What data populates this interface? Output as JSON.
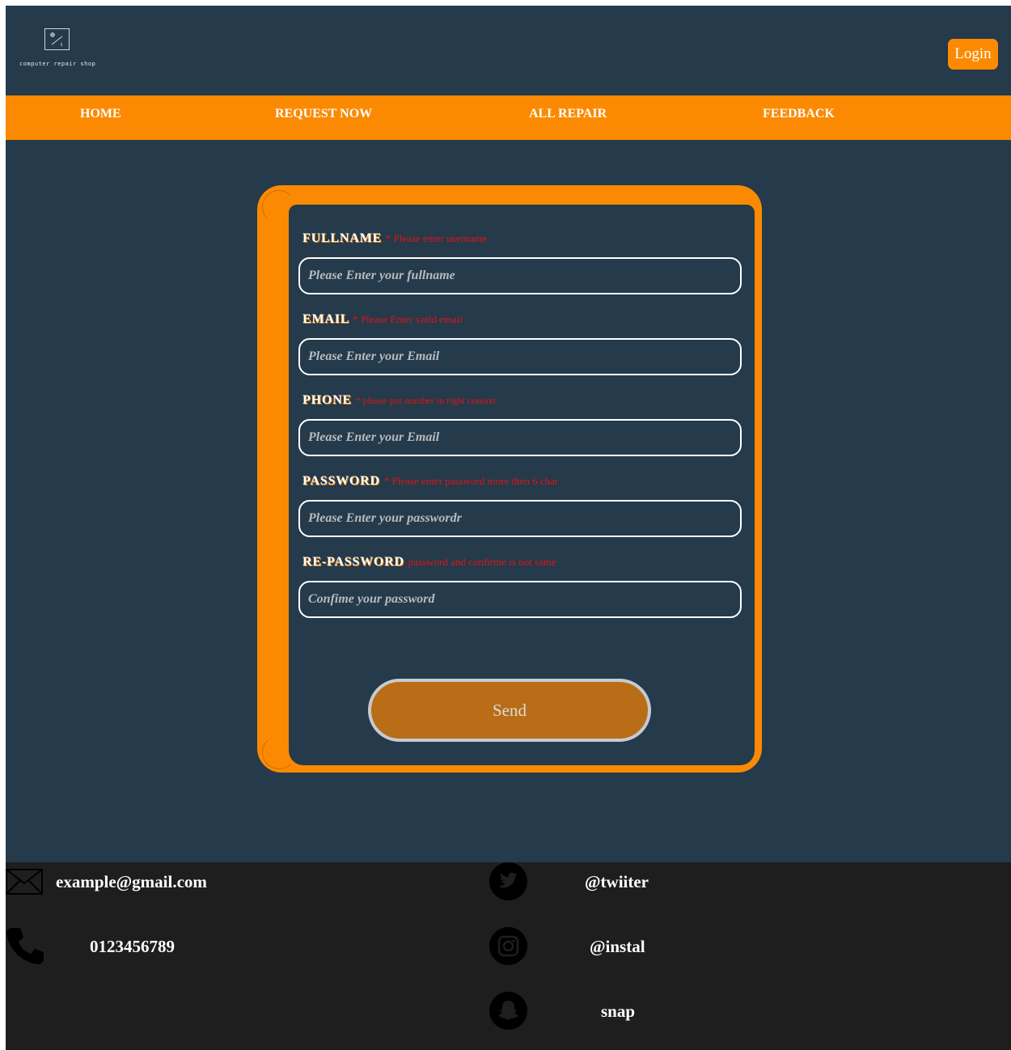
{
  "header": {
    "logo_text": "computer repair shop",
    "login_label": "Login"
  },
  "nav": {
    "items": [
      {
        "label": "HOME"
      },
      {
        "label": "REQUEST NOW"
      },
      {
        "label": "ALL REPAIR"
      },
      {
        "label": "FEEDBACK"
      }
    ]
  },
  "form": {
    "fields": [
      {
        "label": "FULLNAME",
        "error": "* Please enter username",
        "placeholder": "Please Enter your fullname"
      },
      {
        "label": "EMAIL",
        "error": "* Please Enter vaild email",
        "placeholder": "Please Enter your Email"
      },
      {
        "label": "PHONE",
        "error": "* please put number in right contaxt",
        "placeholder": "Please Enter your Email"
      },
      {
        "label": "PASSWORD",
        "error": "* Please enter password more then 6 char",
        "placeholder": "Please Enter your passwordr"
      },
      {
        "label": "RE-PASSWORD",
        "error": "password and confirme is not same",
        "placeholder": "Confime your password"
      }
    ],
    "send_label": "Send"
  },
  "footer": {
    "email": "example@gmail.com",
    "phone": "0123456789",
    "twitter": "@twiiter",
    "instagram": "@instal",
    "snap": "snap"
  },
  "colors": {
    "background": "#253a4a",
    "accent": "#fb8a02",
    "footer": "#1e1e1e",
    "error": "#e01515",
    "send_button": "#ba6d17"
  }
}
